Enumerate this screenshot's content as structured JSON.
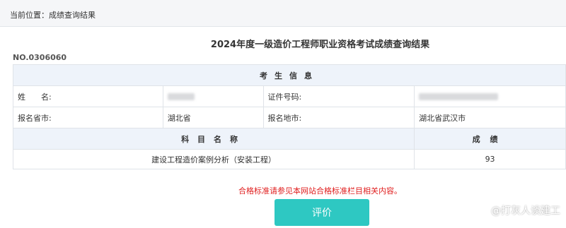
{
  "breadcrumb": {
    "prefix": "当前位置：",
    "current": "成绩查询结果"
  },
  "title": "2024年度一级造价工程师职业资格考试成绩查询结果",
  "record_no": "NO.0306060",
  "info_header": "考生信息",
  "fields": {
    "name_label": "姓　　名:",
    "id_label": "证件号码:",
    "province_label": "报名省市:",
    "province_value": "湖北省",
    "city_label": "报名地市:",
    "city_value": "湖北省武汉市"
  },
  "subjects": {
    "name_header": "科目名称",
    "score_header": "成绩",
    "rows": [
      {
        "name": "建设工程造价案例分析（安装工程）",
        "score": "93"
      }
    ]
  },
  "note": "合格标准请参见本网站合格标准栏目相关内容。",
  "evaluate_button": "评价",
  "watermark": "@打灰人谈建工",
  "colors": {
    "button": "#2ec8c2",
    "note": "#e02020",
    "header_bg": "#eef3fa"
  }
}
